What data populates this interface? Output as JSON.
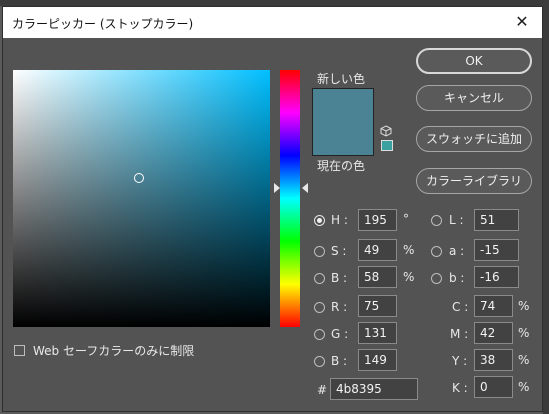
{
  "title": "カラーピッカー (ストップカラー)",
  "close_glyph": "✕",
  "new_color_label": "新しい色",
  "current_color_label": "現在の色",
  "new_color": "#4b8395",
  "current_color": "#4b8395",
  "websafe_swatch_color": "#3aa0a0",
  "buttons": {
    "ok": "OK",
    "cancel": "キャンセル",
    "add_swatch": "スウォッチに追加",
    "library": "カラーライブラリ"
  },
  "field_marker": {
    "saturation": 0.49,
    "brightness": 0.58
  },
  "hue_slider_value": 195,
  "hsb": {
    "h": {
      "label": "H :",
      "value": "195",
      "unit": "°"
    },
    "s": {
      "label": "S :",
      "value": "49",
      "unit": "%"
    },
    "b": {
      "label": "B :",
      "value": "58",
      "unit": "%"
    }
  },
  "lab": {
    "l": {
      "label": "L :",
      "value": "51"
    },
    "a": {
      "label": "a :",
      "value": "-15"
    },
    "b": {
      "label": "b :",
      "value": "-16"
    }
  },
  "rgb": {
    "r": {
      "label": "R :",
      "value": "75"
    },
    "g": {
      "label": "G :",
      "value": "131"
    },
    "b": {
      "label": "B :",
      "value": "149"
    }
  },
  "cmyk": {
    "c": {
      "label": "C :",
      "value": "74",
      "unit": "%"
    },
    "m": {
      "label": "M :",
      "value": "42",
      "unit": "%"
    },
    "y": {
      "label": "Y :",
      "value": "38",
      "unit": "%"
    },
    "k": {
      "label": "K :",
      "value": "0",
      "unit": "%"
    }
  },
  "hex": {
    "label": "#",
    "value": "4b8395"
  },
  "web_safe_label": "Web セーフカラーのみに制限"
}
